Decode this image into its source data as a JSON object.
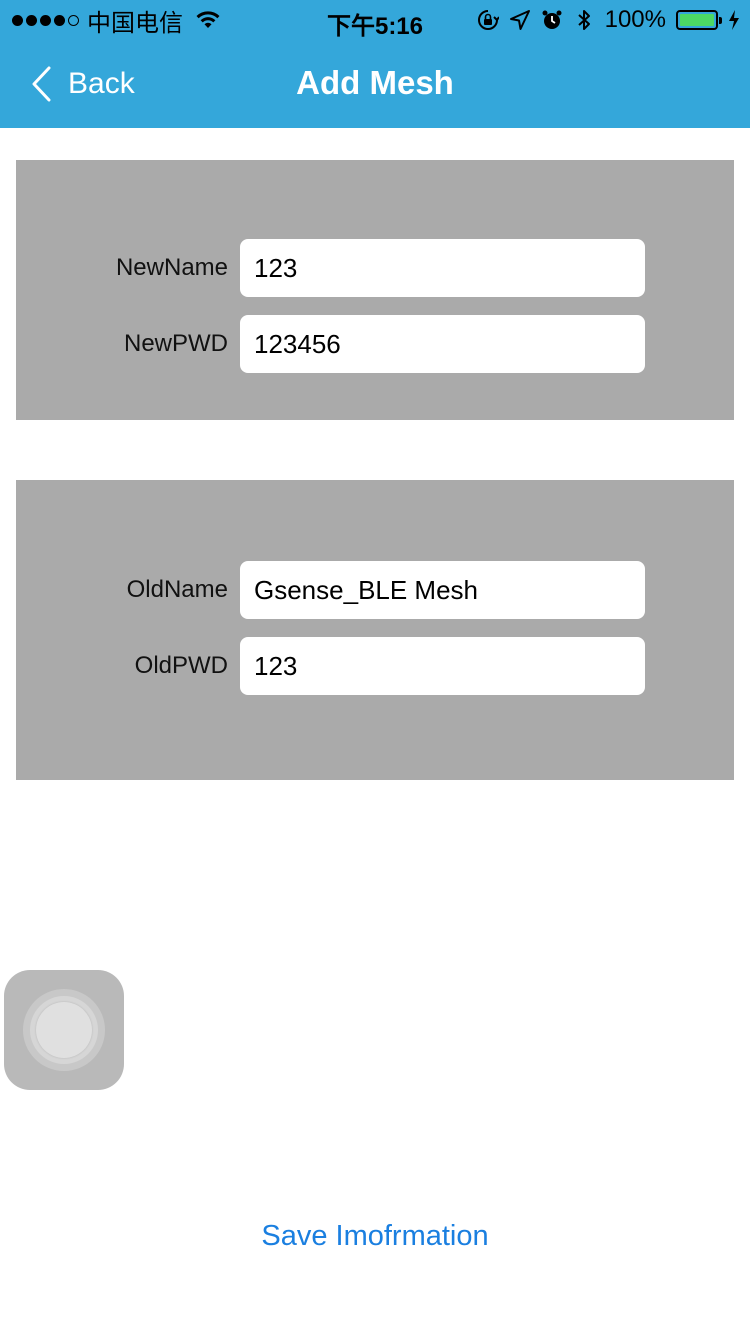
{
  "status_bar": {
    "carrier": "中国电信",
    "time": "下午5:16",
    "battery_percent": "100%",
    "signal_bars_filled": 4,
    "signal_bars_total": 5
  },
  "nav": {
    "back_label": "Back",
    "title": "Add Mesh"
  },
  "new_section": {
    "name_label": "NewName",
    "name_value": "123",
    "pwd_label": "NewPWD",
    "pwd_value": "123456"
  },
  "old_section": {
    "name_label": "OldName",
    "name_value": "Gsense_BLE Mesh",
    "pwd_label": "OldPWD",
    "pwd_value": "123"
  },
  "actions": {
    "save_label": "Save Imofrmation"
  },
  "colors": {
    "header": "#34a7da",
    "panel": "#aaaaaa",
    "link": "#1a7fe0",
    "battery": "#4cd964"
  },
  "icons": {
    "back": "chevron-left-icon",
    "wifi": "wifi-icon",
    "orientation_lock": "orientation-lock-icon",
    "location": "location-arrow-icon",
    "alarm": "alarm-icon",
    "bluetooth": "bluetooth-icon",
    "charging": "charging-bolt-icon",
    "assistive_touch": "assistive-touch-icon"
  }
}
